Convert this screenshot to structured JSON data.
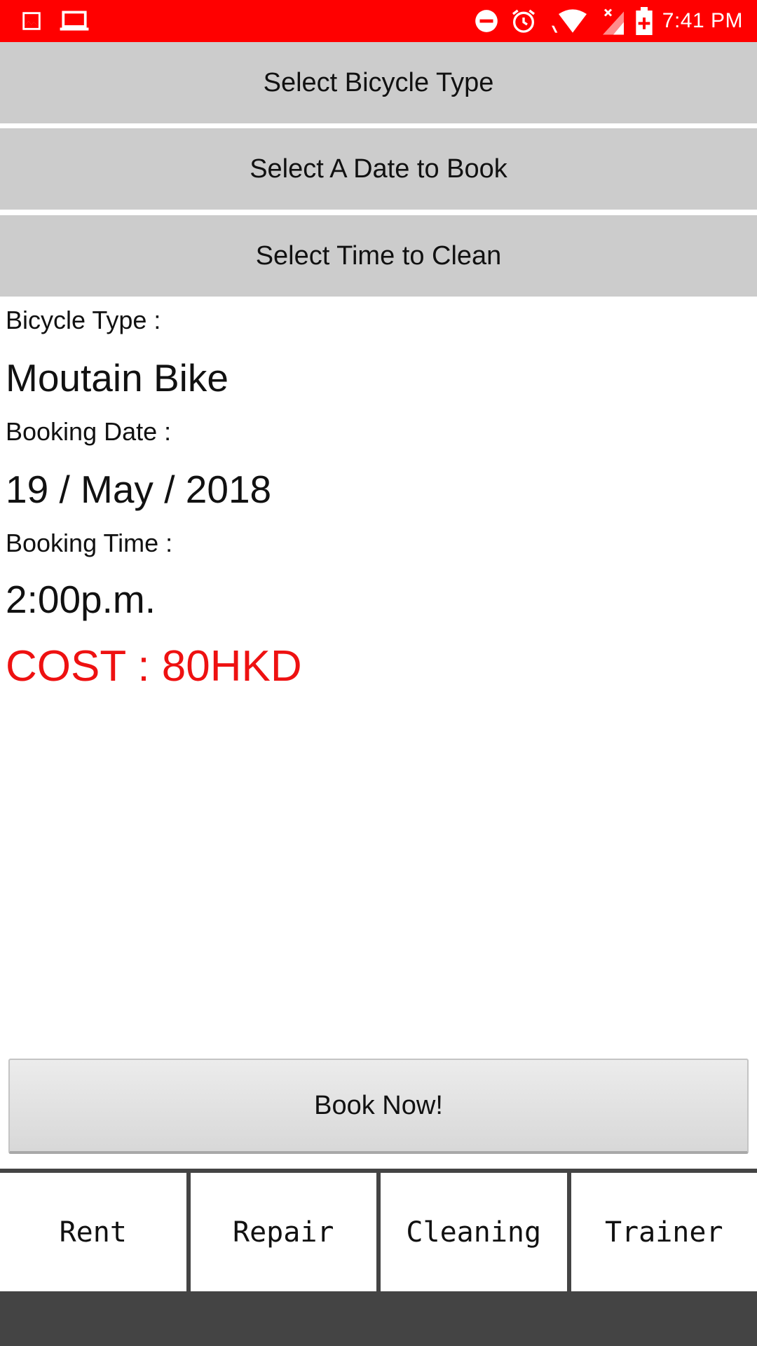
{
  "status_bar": {
    "time": "7:41 PM",
    "icons_left": [
      "image-icon",
      "laptop-icon"
    ],
    "icons_right": [
      "do-not-disturb-icon",
      "alarm-icon",
      "wifi-icon",
      "signal-icon",
      "battery-icon"
    ],
    "background_color": "#ff0000"
  },
  "selectors": {
    "bicycle_type_label": "Select Bicycle Type",
    "date_label": "Select A Date to Book",
    "time_label": "Select Time to Clean"
  },
  "details": {
    "bicycle_type_label": "Bicycle Type :",
    "bicycle_type_value": "Moutain Bike",
    "booking_date_label": "Booking Date :",
    "booking_date_value": "19 / May / 2018",
    "booking_time_label": "Booking Time :",
    "booking_time_value": "2:00p.m.",
    "cost": "COST : 80HKD",
    "cost_color": "#ee1111"
  },
  "book_button": {
    "label": "Book Now!"
  },
  "tabs": [
    {
      "label": "Rent"
    },
    {
      "label": "Repair"
    },
    {
      "label": "Cleaning"
    },
    {
      "label": "Trainer"
    }
  ]
}
